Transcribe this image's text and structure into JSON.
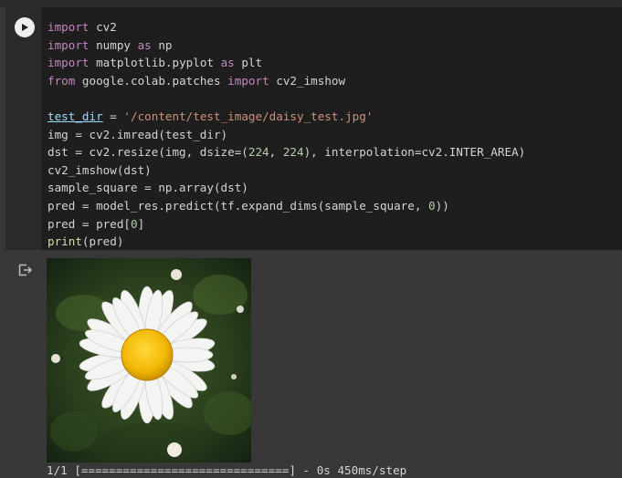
{
  "cell": {
    "code_lines": [
      [
        {
          "t": "import",
          "c": "kw"
        },
        {
          "t": " cv2"
        }
      ],
      [
        {
          "t": "import",
          "c": "kw"
        },
        {
          "t": " numpy "
        },
        {
          "t": "as",
          "c": "kw"
        },
        {
          "t": " np"
        }
      ],
      [
        {
          "t": "import",
          "c": "kw"
        },
        {
          "t": " matplotlib.pyplot "
        },
        {
          "t": "as",
          "c": "kw"
        },
        {
          "t": " plt"
        }
      ],
      [
        {
          "t": "from",
          "c": "kw"
        },
        {
          "t": " google.colab.patches "
        },
        {
          "t": "import",
          "c": "kw"
        },
        {
          "t": " cv2_imshow"
        }
      ],
      [],
      [
        {
          "t": "test_dir",
          "c": "var"
        },
        {
          "t": " = "
        },
        {
          "t": "'/content/test_image/daisy_test.jpg'",
          "c": "str"
        }
      ],
      [
        {
          "t": "img = cv2.imread(test_dir)"
        }
      ],
      [
        {
          "t": "dst = cv2.resize(img, dsize=("
        },
        {
          "t": "224",
          "c": "num"
        },
        {
          "t": ", "
        },
        {
          "t": "224",
          "c": "num"
        },
        {
          "t": "), interpolation=cv2.INTER_AREA)"
        }
      ],
      [
        {
          "t": "cv2_imshow(dst)"
        }
      ],
      [
        {
          "t": "sample_square = np.array(dst)"
        }
      ],
      [
        {
          "t": "pred = model_res.predict(tf.expand_dims(sample_square, "
        },
        {
          "t": "0",
          "c": "num"
        },
        {
          "t": "))"
        }
      ],
      [
        {
          "t": "pred = pred["
        },
        {
          "t": "0",
          "c": "num"
        },
        {
          "t": "]"
        }
      ],
      [
        {
          "t": "print",
          "c": "fn"
        },
        {
          "t": "(pred)"
        }
      ]
    ]
  },
  "output": {
    "progress_text": "1/1 [==============================] - 0s 450ms/step"
  },
  "icons": {
    "run": "play-icon",
    "output": "output-icon"
  },
  "colors": {
    "page_bg": "#383838",
    "cell_bg": "#1e1e1e",
    "keyword": "#c586c0",
    "number": "#b5cea8",
    "string": "#ce9178"
  }
}
